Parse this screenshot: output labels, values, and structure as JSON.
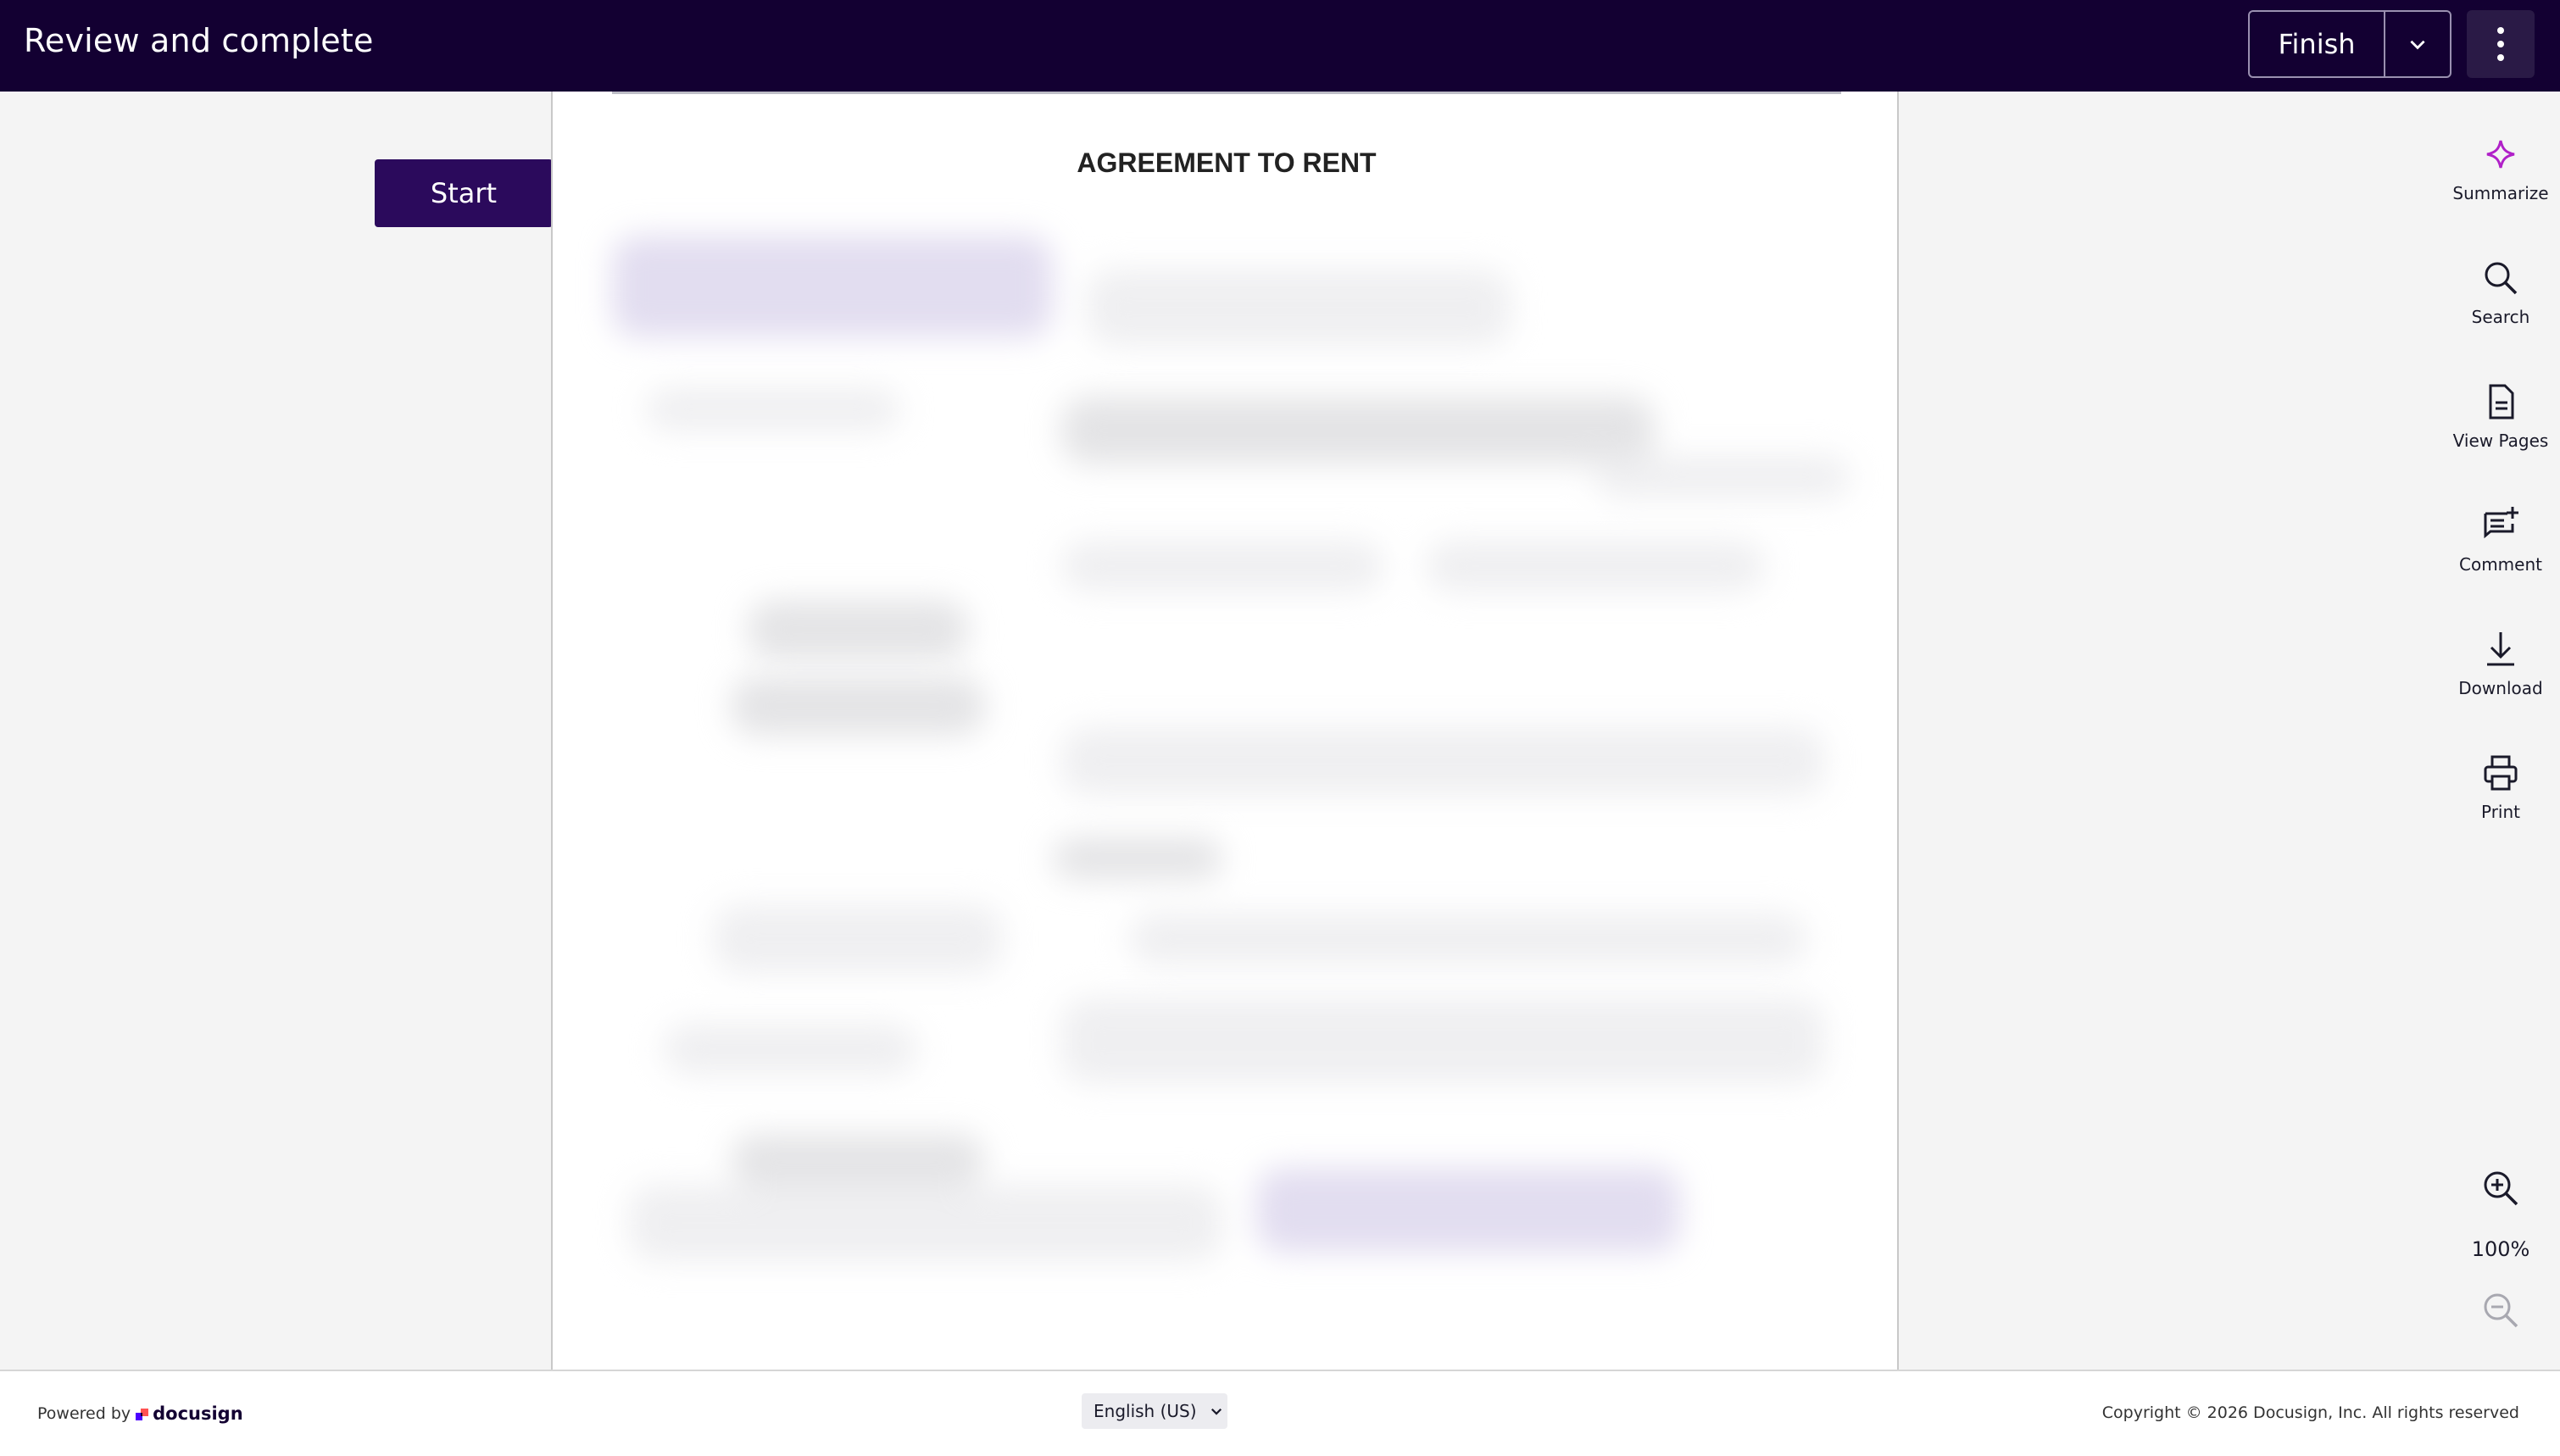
{
  "header": {
    "title": "Review and complete",
    "finish_label": "Finish"
  },
  "start_label": "Start",
  "document": {
    "title": "AGREEMENT TO RENT"
  },
  "rail": {
    "summarize": "Summarize",
    "search": "Search",
    "view_pages": "View Pages",
    "comment": "Comment",
    "download": "Download",
    "print": "Print"
  },
  "zoom": {
    "level": "100%"
  },
  "footer": {
    "powered_by": "Powered by",
    "brand": "docusign",
    "language": "English (US)",
    "copyright": "Copyright © 2026 Docusign, Inc. All rights reserved"
  },
  "colors": {
    "header_bg": "#130032",
    "primary_button": "#2b0a5c",
    "accent": "#b020c8"
  }
}
